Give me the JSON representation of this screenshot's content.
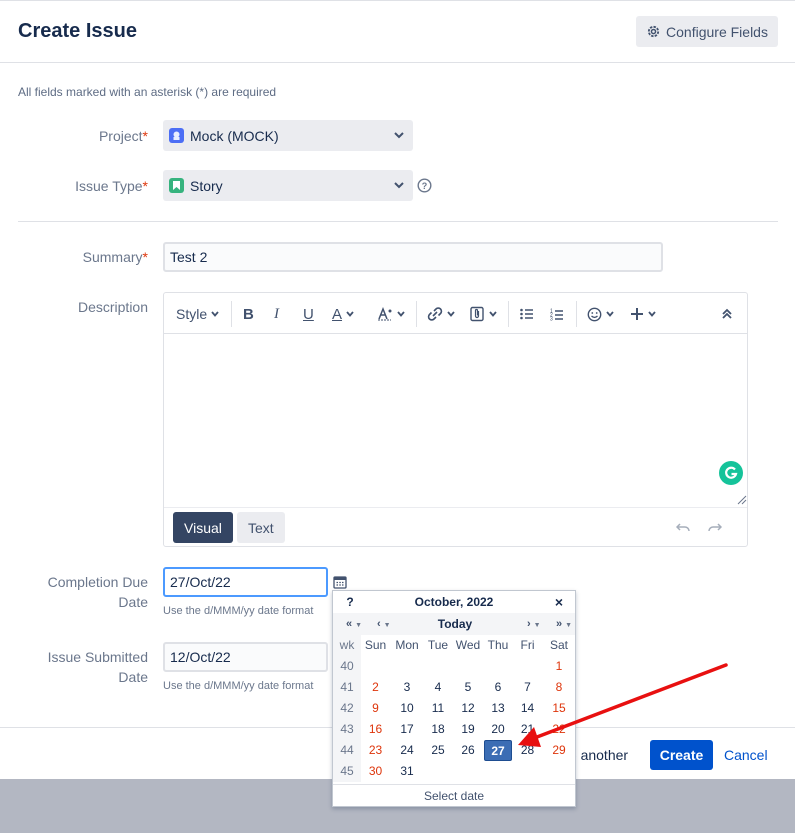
{
  "header": {
    "title": "Create Issue",
    "configure_fields_label": "Configure Fields"
  },
  "required_note": "All fields marked with an asterisk (*) are required",
  "fields": {
    "project": {
      "label": "Project",
      "value": "Mock (MOCK)"
    },
    "issue_type": {
      "label": "Issue Type",
      "value": "Story"
    },
    "summary": {
      "label": "Summary",
      "value": "Test 2"
    },
    "description": {
      "label": "Description"
    },
    "completion_due_date": {
      "label_line1": "Completion Due",
      "label_line2": "Date",
      "value": "27/Oct/22",
      "hint": "Use the d/MMM/yy date format"
    },
    "issue_submitted_date": {
      "label_line1": "Issue Submitted",
      "label_line2": "Date",
      "value": "12/Oct/22",
      "hint": "Use the d/MMM/yy date format"
    }
  },
  "editor": {
    "style_label": "Style",
    "tabs": {
      "visual": "Visual",
      "text": "Text"
    },
    "toolbar_icons": [
      "bold-icon",
      "italic-icon",
      "underline-icon",
      "text-color-icon",
      "text-format-icon",
      "link-icon",
      "attachment-icon",
      "bullet-list-icon",
      "numbered-list-icon",
      "emoji-icon",
      "insert-more-icon",
      "collapse-toolbar-icon"
    ]
  },
  "calendar": {
    "help": "?",
    "month_year": "October, 2022",
    "close": "×",
    "nav": {
      "prev_year": "«",
      "prev_month": "‹",
      "today": "Today",
      "next_month": "›",
      "next_year": "»"
    },
    "weekday_headers": [
      "wk",
      "Sun",
      "Mon",
      "Tue",
      "Wed",
      "Thu",
      "Fri",
      "Sat"
    ],
    "weeks": [
      {
        "wk": "40",
        "days": [
          "",
          "",
          "",
          "",
          "",
          "",
          "1"
        ]
      },
      {
        "wk": "41",
        "days": [
          "2",
          "3",
          "4",
          "5",
          "6",
          "7",
          "8"
        ]
      },
      {
        "wk": "42",
        "days": [
          "9",
          "10",
          "11",
          "12",
          "13",
          "14",
          "15"
        ]
      },
      {
        "wk": "43",
        "days": [
          "16",
          "17",
          "18",
          "19",
          "20",
          "21",
          "22"
        ]
      },
      {
        "wk": "44",
        "days": [
          "23",
          "24",
          "25",
          "26",
          "27",
          "28",
          "29"
        ]
      },
      {
        "wk": "45",
        "days": [
          "30",
          "31",
          "",
          "",
          "",
          "",
          ""
        ]
      }
    ],
    "selected_day": "27",
    "footer": "Select date"
  },
  "footer": {
    "create_another_label": "te another",
    "create_label": "Create",
    "cancel_label": "Cancel"
  },
  "colors": {
    "primary": "#0052cc",
    "required": "#de350b",
    "selected_day": "#3b6db4",
    "arrow": "#e81010",
    "grammarly": "#15c39a"
  }
}
